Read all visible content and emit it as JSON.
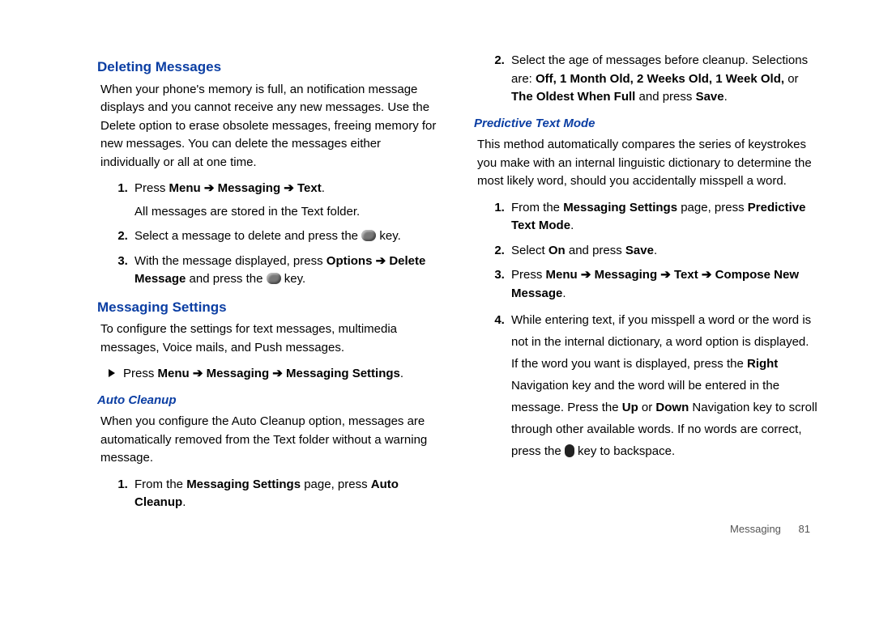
{
  "left": {
    "h1": "Deleting Messages",
    "p1": "When your phone's memory is full, an notification message displays and you cannot receive any new messages. Use the Delete option to erase obsolete messages, freeing memory for new messages. You can delete the messages either individually or all at one time.",
    "l1a_pre": "Press ",
    "l1a_b": "Menu ➔ Messaging ➔ Text",
    "l1a_post": ".",
    "l1a_sub": "All messages are stored in the Text folder.",
    "l1b_pre": "Select a message to delete and press the ",
    "l1b_post": " key.",
    "l1c_pre": "With the message displayed, press ",
    "l1c_b1": "Options ➔ Delete Message",
    "l1c_mid": " and press the ",
    "l1c_post": " key.",
    "h2": "Messaging Settings",
    "p2": "To configure the settings for text messages, multimedia messages, Voice mails, and Push messages.",
    "bullet_pre": "Press ",
    "bullet_b": "Menu ➔ Messaging ➔ Messaging Settings",
    "bullet_post": ".",
    "h3": "Auto Cleanup",
    "p3": "When you configure the Auto Cleanup option, messages are automatically removed from the Text folder without a warning message.",
    "l2a_pre": "From the ",
    "l2a_b1": "Messaging Settings",
    "l2a_mid": " page, press ",
    "l2a_b2": "Auto Cleanup",
    "l2a_post": "."
  },
  "right": {
    "l2b_pre": "Select the age of messages before cleanup. Selections are: ",
    "l2b_b": "Off, 1 Month Old, 2 Weeks Old, 1 Week Old, ",
    "l2b_mid": "or ",
    "l2b_b2": "The Oldest When Full",
    "l2b_mid2": " and press ",
    "l2b_b3": "Save",
    "l2b_post": ".",
    "h1": "Predictive Text Mode",
    "p1": "This method automatically compares the series of keystrokes you make with an internal linguistic dictionary to determine the most likely word, should you accidentally misspell a word.",
    "r1_pre": "From the ",
    "r1_b1": "Messaging Settings",
    "r1_mid": " page, press ",
    "r1_b2": "Predictive Text Mode",
    "r1_post": ".",
    "r2_pre": "Select ",
    "r2_b1": "On",
    "r2_mid": " and press ",
    "r2_b2": "Save",
    "r2_post": ".",
    "r3_pre": "Press ",
    "r3_b": "Menu ➔ Messaging ➔ Text ➔ Compose New Message",
    "r3_post": ".",
    "r4_pre": "While entering text, if you misspell a word or the word is not in the internal dictionary, a word option is displayed. If the word you want is displayed, press the ",
    "r4_b1": "Right",
    "r4_mid1": " Navigation key and the word will be entered in the message. Press the ",
    "r4_b2": "Up",
    "r4_mid2": " or ",
    "r4_b3": "Down",
    "r4_mid3": " Navigation key to scroll through other available words. If no words are correct, press the ",
    "r4_post": " key to backspace."
  },
  "footer": {
    "label": "Messaging",
    "page": "81"
  }
}
